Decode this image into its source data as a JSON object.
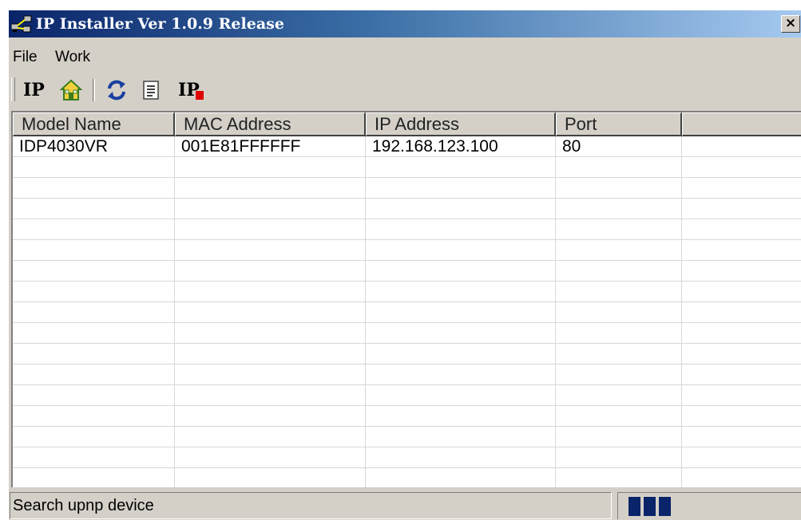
{
  "window": {
    "title": "IP Installer Ver 1.0.9 Release",
    "close_label": "×"
  },
  "menu": {
    "items": [
      {
        "label": "File"
      },
      {
        "label": "Work"
      }
    ]
  },
  "toolbar": {
    "buttons": [
      {
        "icon": "ip-text-icon",
        "label": "IP"
      },
      {
        "icon": "home-icon"
      },
      {
        "icon": "refresh-icon"
      },
      {
        "icon": "list-icon"
      },
      {
        "icon": "ip-red-icon",
        "label": "IP"
      }
    ]
  },
  "table": {
    "columns": [
      "Model Name",
      "MAC Address",
      "IP Address",
      "Port",
      ""
    ],
    "rows": [
      [
        "IDP4030VR",
        "001E81FFFFFF",
        "192.168.123.100",
        "80",
        ""
      ]
    ]
  },
  "status": {
    "text": "Search upnp device",
    "progress_blocks": 3
  },
  "colors": {
    "title_gradient_start": "#0a246a",
    "title_gradient_end": "#a6caf0",
    "progress": "#0a246a",
    "window_face": "#d4d0c8"
  }
}
